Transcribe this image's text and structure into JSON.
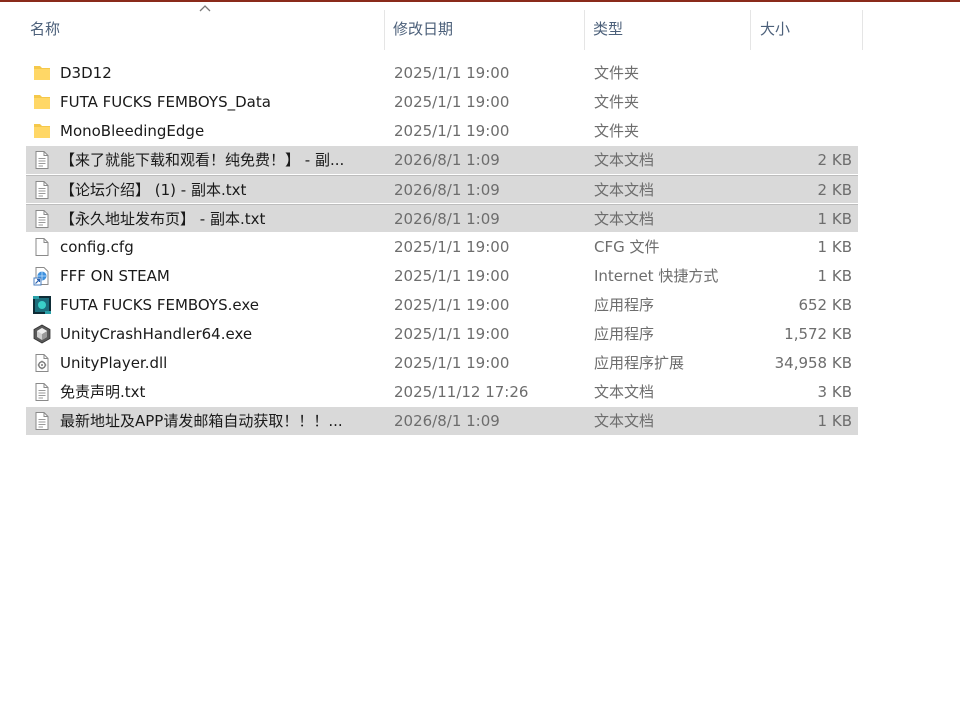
{
  "columns": {
    "name": "名称",
    "date": "修改日期",
    "type": "类型",
    "size": "大小"
  },
  "files": [
    {
      "name": "D3D12",
      "date": "2025/1/1 19:00",
      "type": "文件夹",
      "size": "",
      "icon": "folder-icon",
      "selected": false
    },
    {
      "name": "FUTA FUCKS FEMBOYS_Data",
      "date": "2025/1/1 19:00",
      "type": "文件夹",
      "size": "",
      "icon": "folder-icon",
      "selected": false
    },
    {
      "name": "MonoBleedingEdge",
      "date": "2025/1/1 19:00",
      "type": "文件夹",
      "size": "",
      "icon": "folder-icon",
      "selected": false
    },
    {
      "name": "【来了就能下载和观看！纯免费！】 - 副...",
      "date": "2026/8/1 1:09",
      "type": "文本文档",
      "size": "2 KB",
      "icon": "text-file-icon",
      "selected": true
    },
    {
      "name": "【论坛介绍】 (1) - 副本.txt",
      "date": "2026/8/1 1:09",
      "type": "文本文档",
      "size": "2 KB",
      "icon": "text-file-icon",
      "selected": true
    },
    {
      "name": "【永久地址发布页】 - 副本.txt",
      "date": "2026/8/1 1:09",
      "type": "文本文档",
      "size": "1 KB",
      "icon": "text-file-icon",
      "selected": true
    },
    {
      "name": "config.cfg",
      "date": "2025/1/1 19:00",
      "type": "CFG 文件",
      "size": "1 KB",
      "icon": "blank-file-icon",
      "selected": false
    },
    {
      "name": "FFF ON STEAM",
      "date": "2025/1/1 19:00",
      "type": "Internet 快捷方式",
      "size": "1 KB",
      "icon": "internet-shortcut-icon",
      "selected": false
    },
    {
      "name": "FUTA FUCKS FEMBOYS.exe",
      "date": "2025/1/1 19:00",
      "type": "应用程序",
      "size": "652 KB",
      "icon": "game-exe-icon",
      "selected": false
    },
    {
      "name": "UnityCrashHandler64.exe",
      "date": "2025/1/1 19:00",
      "type": "应用程序",
      "size": "1,572 KB",
      "icon": "unity-exe-icon",
      "selected": false
    },
    {
      "name": "UnityPlayer.dll",
      "date": "2025/1/1 19:00",
      "type": "应用程序扩展",
      "size": "34,958 KB",
      "icon": "dll-file-icon",
      "selected": false
    },
    {
      "name": "免责声明.txt",
      "date": "2025/11/12 17:26",
      "type": "文本文档",
      "size": "3 KB",
      "icon": "text-file-icon",
      "selected": false
    },
    {
      "name": "最新地址及APP请发邮箱自动获取！！！...",
      "date": "2026/8/1 1:09",
      "type": "文本文档",
      "size": "1 KB",
      "icon": "text-file-icon",
      "selected": true
    }
  ],
  "colors": {
    "selection": "#d9d9d9",
    "folder": "#f5c84a",
    "header_text": "#4c607a"
  }
}
